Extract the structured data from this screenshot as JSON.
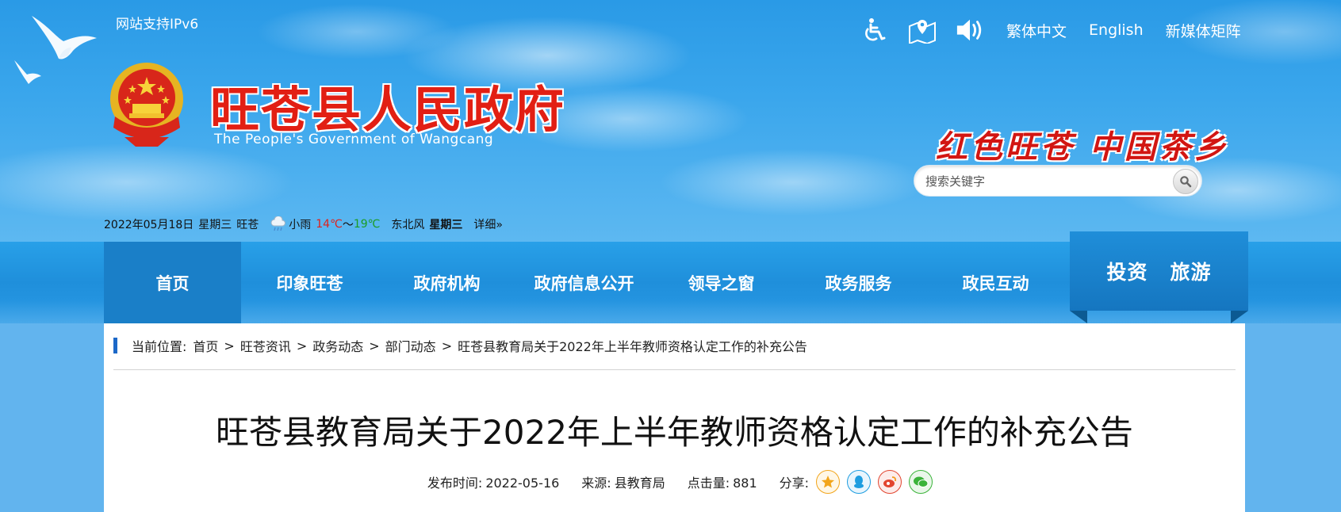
{
  "header": {
    "ipv6_notice": "网站支持IPv6",
    "site_title": "旺苍县人民政府",
    "site_subtitle": "The People's Government of Wangcang",
    "slogan": "红色旺苍 中国茶乡",
    "top_links": [
      {
        "icon": "accessibility-icon"
      },
      {
        "icon": "map-location-icon"
      },
      {
        "icon": "speaker-icon"
      },
      {
        "label": "繁体中文"
      },
      {
        "label": "English"
      },
      {
        "label": "新媒体矩阵"
      }
    ],
    "search": {
      "placeholder": "搜索关键字",
      "icon": "search-icon"
    }
  },
  "weather": {
    "date": "2022年05月18日",
    "weekday": "星期三",
    "city": "旺苍",
    "icon": "rain-cloud-icon",
    "condition": "小雨",
    "temp_low": "14℃",
    "range_sep": "～",
    "temp_high": "19℃",
    "wind": "东北风",
    "weekday_bold": "星期三",
    "detail_link": "详细»"
  },
  "nav": {
    "items": [
      {
        "label": "首页",
        "active": true
      },
      {
        "label": "印象旺苍"
      },
      {
        "label": "政府机构"
      },
      {
        "label": "政府信息公开"
      },
      {
        "label": "领导之窗"
      },
      {
        "label": "政务服务"
      },
      {
        "label": "政民互动"
      }
    ],
    "feature_links": [
      "投资",
      "旅游"
    ]
  },
  "breadcrumb": {
    "prefix": "当前位置:",
    "items": [
      "首页",
      "旺苍资讯",
      "政务动态",
      "部门动态",
      "旺苍县教育局关于2022年上半年教师资格认定工作的补充公告"
    ],
    "separator": ">"
  },
  "article": {
    "title": "旺苍县教育局关于2022年上半年教师资格认定工作的补充公告",
    "publish_label": "发布时间:",
    "publish_date": "2022-05-16",
    "source_label": "来源:",
    "source": "县教育局",
    "views_label": "点击量:",
    "views": "881",
    "share_label": "分享:",
    "share_icons": [
      {
        "icon": "qzone-star-icon",
        "color": "#f2a51b"
      },
      {
        "icon": "qq-icon",
        "color": "#1e9de0"
      },
      {
        "icon": "weibo-icon",
        "color": "#e2452f"
      },
      {
        "icon": "wechat-icon",
        "color": "#3bb33a"
      }
    ]
  },
  "colors": {
    "accent_blue": "#1f8fdb",
    "title_red": "#e21f13",
    "breadcrumb_bar": "#1c68c8"
  }
}
